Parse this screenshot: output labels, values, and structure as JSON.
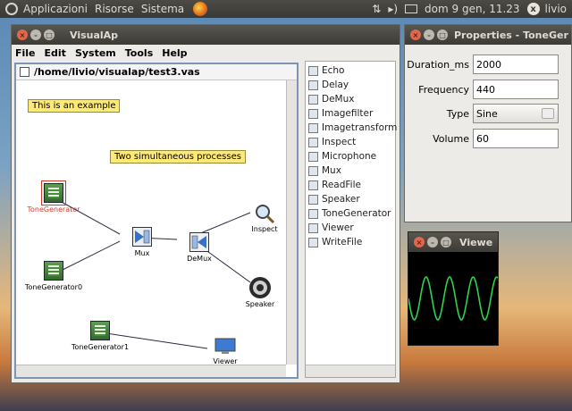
{
  "panel": {
    "menus": [
      "Applicazioni",
      "Risorse",
      "Sistema"
    ],
    "datetime": "dom  9 gen, 11.23",
    "user": "livio",
    "net_indicator": "⇅"
  },
  "visualap": {
    "title": "VisualAp",
    "menu": [
      "File",
      "Edit",
      "System",
      "Tools",
      "Help"
    ],
    "canvas_title": "/home/livio/visualap/test3.vas",
    "notes": [
      "This is an example",
      "Two simultaneous processes"
    ],
    "nodes": {
      "tg": "ToneGenerator",
      "tg0": "ToneGenerator0",
      "mux": "Mux",
      "demux": "DeMux",
      "inspect": "Inspect",
      "speaker": "Speaker",
      "tg1": "ToneGenerator1",
      "viewer": "Viewer"
    },
    "palette": [
      {
        "label": "Echo",
        "icon": "echo-icon"
      },
      {
        "label": "Delay",
        "icon": "delay-icon"
      },
      {
        "label": "DeMux",
        "icon": "demux-icon"
      },
      {
        "label": "Imagefilter",
        "icon": "imagefilter-icon"
      },
      {
        "label": "Imagetransform",
        "icon": "imagetransform-icon"
      },
      {
        "label": "Inspect",
        "icon": "inspect-icon"
      },
      {
        "label": "Microphone",
        "icon": "microphone-icon"
      },
      {
        "label": "Mux",
        "icon": "mux-icon"
      },
      {
        "label": "ReadFile",
        "icon": "readfile-icon"
      },
      {
        "label": "Speaker",
        "icon": "speaker-icon"
      },
      {
        "label": "ToneGenerator",
        "icon": "tonegenerator-icon"
      },
      {
        "label": "Viewer",
        "icon": "viewer-icon"
      },
      {
        "label": "WriteFile",
        "icon": "writefile-icon"
      }
    ]
  },
  "properties": {
    "title": "Properties - ToneGer",
    "fields": [
      {
        "label": "Duration_ms",
        "value": "2000"
      },
      {
        "label": "Frequency",
        "value": "440"
      },
      {
        "label": "Type",
        "value": "Sine"
      },
      {
        "label": "Volume",
        "value": "60"
      }
    ]
  },
  "viewer": {
    "title": "Viewe"
  },
  "colors": {
    "panel": "#3f3e3a",
    "titlebar": "#48463f",
    "note": "#fde978",
    "wave": "#2fd34a",
    "selected": "#d03a2c"
  }
}
